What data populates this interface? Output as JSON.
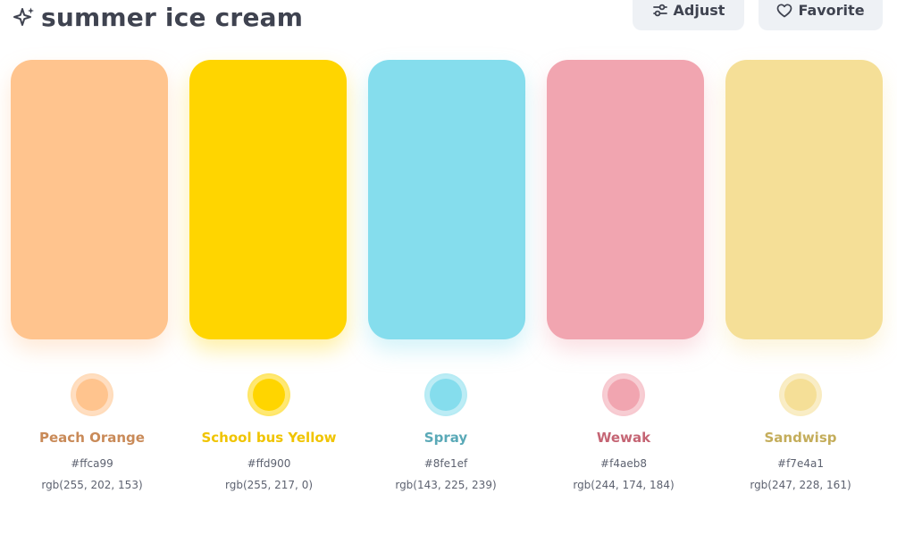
{
  "header": {
    "title": "summer ice cream",
    "title_icon": "sparkles-icon",
    "adjust_label": "Adjust",
    "adjust_icon": "sliders-icon",
    "favorite_label": "Favorite",
    "favorite_icon": "heart-icon"
  },
  "palette": [
    {
      "name": "Peach Orange",
      "hex": "#ffca99",
      "rgb": "rgb(255, 202, 153)",
      "swatch": "#ffc48e",
      "label_color": "#c98a58"
    },
    {
      "name": "School bus Yellow",
      "hex": "#ffd900",
      "rgb": "rgb(255, 217, 0)",
      "swatch": "#ffd500",
      "label_color": "#f0c400"
    },
    {
      "name": "Spray",
      "hex": "#8fe1ef",
      "rgb": "rgb(143, 225, 239)",
      "swatch": "#85dded",
      "label_color": "#5aa9b7"
    },
    {
      "name": "Wewak",
      "hex": "#f4aeb8",
      "rgb": "rgb(244, 174, 184)",
      "swatch": "#f1a5b0",
      "label_color": "#c56574"
    },
    {
      "name": "Sandwisp",
      "hex": "#f7e4a1",
      "rgb": "rgb(247, 228, 161)",
      "swatch": "#f5df97",
      "label_color": "#c4ad5b"
    }
  ]
}
